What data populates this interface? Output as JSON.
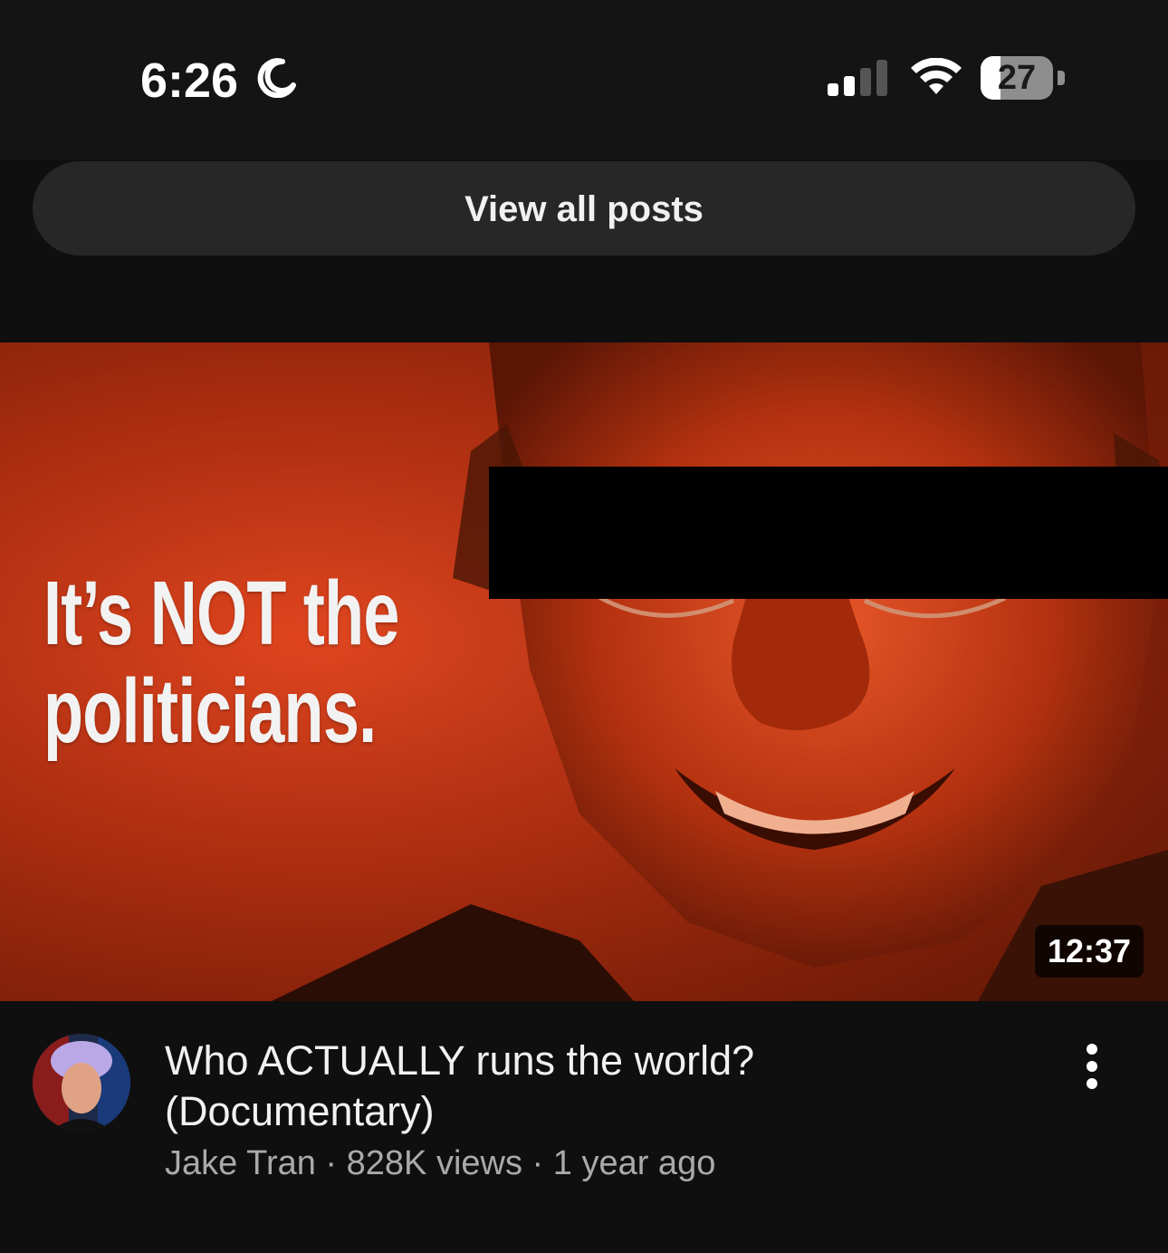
{
  "status_bar": {
    "time": "6:26",
    "battery_percent": "27",
    "icons": [
      "moon-icon",
      "cellular-signal-icon",
      "wifi-icon",
      "battery-icon"
    ]
  },
  "posts": {
    "view_all_label": "View all posts"
  },
  "video": {
    "thumbnail_text": "It’s NOT the politicians.",
    "duration": "12:37",
    "title": "Who ACTUALLY runs the world? (Documentary)",
    "channel": "Jake Tran",
    "views": "828K views",
    "age": "1 year ago",
    "separator": " · "
  },
  "colors": {
    "background": "#0f0f0f",
    "chip": "#272727",
    "thumbnail_red": "#d23d17",
    "meta_text": "#aaaaaa"
  }
}
